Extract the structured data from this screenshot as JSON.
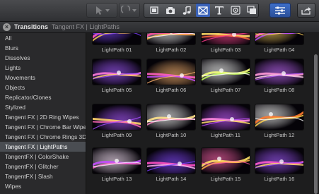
{
  "toolbar": {
    "tools": [
      {
        "name": "select-tool-icon"
      },
      {
        "name": "retime-tool-icon"
      }
    ],
    "browsers": [
      {
        "name": "clip-browser-icon"
      },
      {
        "name": "photo-browser-icon"
      },
      {
        "name": "music-browser-icon"
      },
      {
        "name": "transitions-browser-icon",
        "selected": true
      },
      {
        "name": "titles-browser-icon"
      },
      {
        "name": "generators-browser-icon"
      },
      {
        "name": "themes-browser-icon"
      }
    ],
    "inspector": {
      "name": "inspector-icon"
    },
    "share": {
      "name": "share-icon"
    }
  },
  "header": {
    "title": "Transitions",
    "breadcrumb": "Tangent FX | LightPaths"
  },
  "sidebar": {
    "items": [
      {
        "label": "All"
      },
      {
        "label": "Blurs"
      },
      {
        "label": "Dissolves"
      },
      {
        "label": "Lights"
      },
      {
        "label": "Movements"
      },
      {
        "label": "Objects"
      },
      {
        "label": "Replicator/Clones"
      },
      {
        "label": "Stylized"
      },
      {
        "label": "Tangent FX | 2D Ring Wipes"
      },
      {
        "label": "Tangent FX | Chrome Bar Wipes"
      },
      {
        "label": "Tangent FX | Chrome Rings 3D"
      },
      {
        "label": "Tangent FX | LightPaths",
        "selected": true
      },
      {
        "label": "TangentFX | ColorShake"
      },
      {
        "label": "TangentFX | Glitcher"
      },
      {
        "label": "TangentFX | Slash"
      },
      {
        "label": "Wipes"
      }
    ]
  },
  "items": [
    {
      "label": "LightPath 01",
      "colors": [
        "#ff5ab8",
        "#ffd04a",
        "#7a3cff"
      ]
    },
    {
      "label": "LightPath 02",
      "colors": [
        "#ff4fa0",
        "#ffb347",
        "#ffffff"
      ]
    },
    {
      "label": "LightPath 03",
      "colors": [
        "#ffe066",
        "#ff6a3d",
        "#ff3c8c"
      ]
    },
    {
      "label": "LightPath 04",
      "colors": [
        "#ff56c8",
        "#b04cff",
        "#ffd35a"
      ]
    },
    {
      "label": "LightPath 05",
      "colors": [
        "#ff7ad9",
        "#ffcf6b",
        "#9b4dff"
      ]
    },
    {
      "label": "LightPath 06",
      "colors": [
        "#ff5fbf",
        "#c44dff",
        "#ffb36b"
      ]
    },
    {
      "label": "LightPath 07",
      "colors": [
        "#f4ff7a",
        "#c5ff5a",
        "#ffffff"
      ]
    },
    {
      "label": "LightPath 08",
      "colors": [
        "#ff9ad6",
        "#ffd1e8",
        "#c060ff"
      ]
    },
    {
      "label": "LightPath 09",
      "colors": [
        "#ffd36b",
        "#ff6ab5",
        "#a64dff"
      ]
    },
    {
      "label": "LightPath 10",
      "colors": [
        "#ffe28a",
        "#ff8ac4",
        "#ffffff"
      ]
    },
    {
      "label": "LightPath 11",
      "colors": [
        "#ff8ae0",
        "#ffe066",
        "#c04dff"
      ]
    },
    {
      "label": "LightPath 12",
      "colors": [
        "#ff7a2e",
        "#ffcf4a",
        "#ffffff"
      ]
    },
    {
      "label": "LightPath 13",
      "colors": [
        "#c44dff",
        "#ff6ad0",
        "#ffe8ff"
      ]
    },
    {
      "label": "LightPath 14",
      "colors": [
        "#ff4fc0",
        "#ffb3ef",
        "#7d3cff"
      ]
    },
    {
      "label": "LightPath 15",
      "colors": [
        "#ffe066",
        "#ffb347",
        "#ff5aa8"
      ]
    },
    {
      "label": "LightPath 16",
      "colors": [
        "#ff5ad0",
        "#ffd96b",
        "#9b4dff"
      ]
    }
  ]
}
